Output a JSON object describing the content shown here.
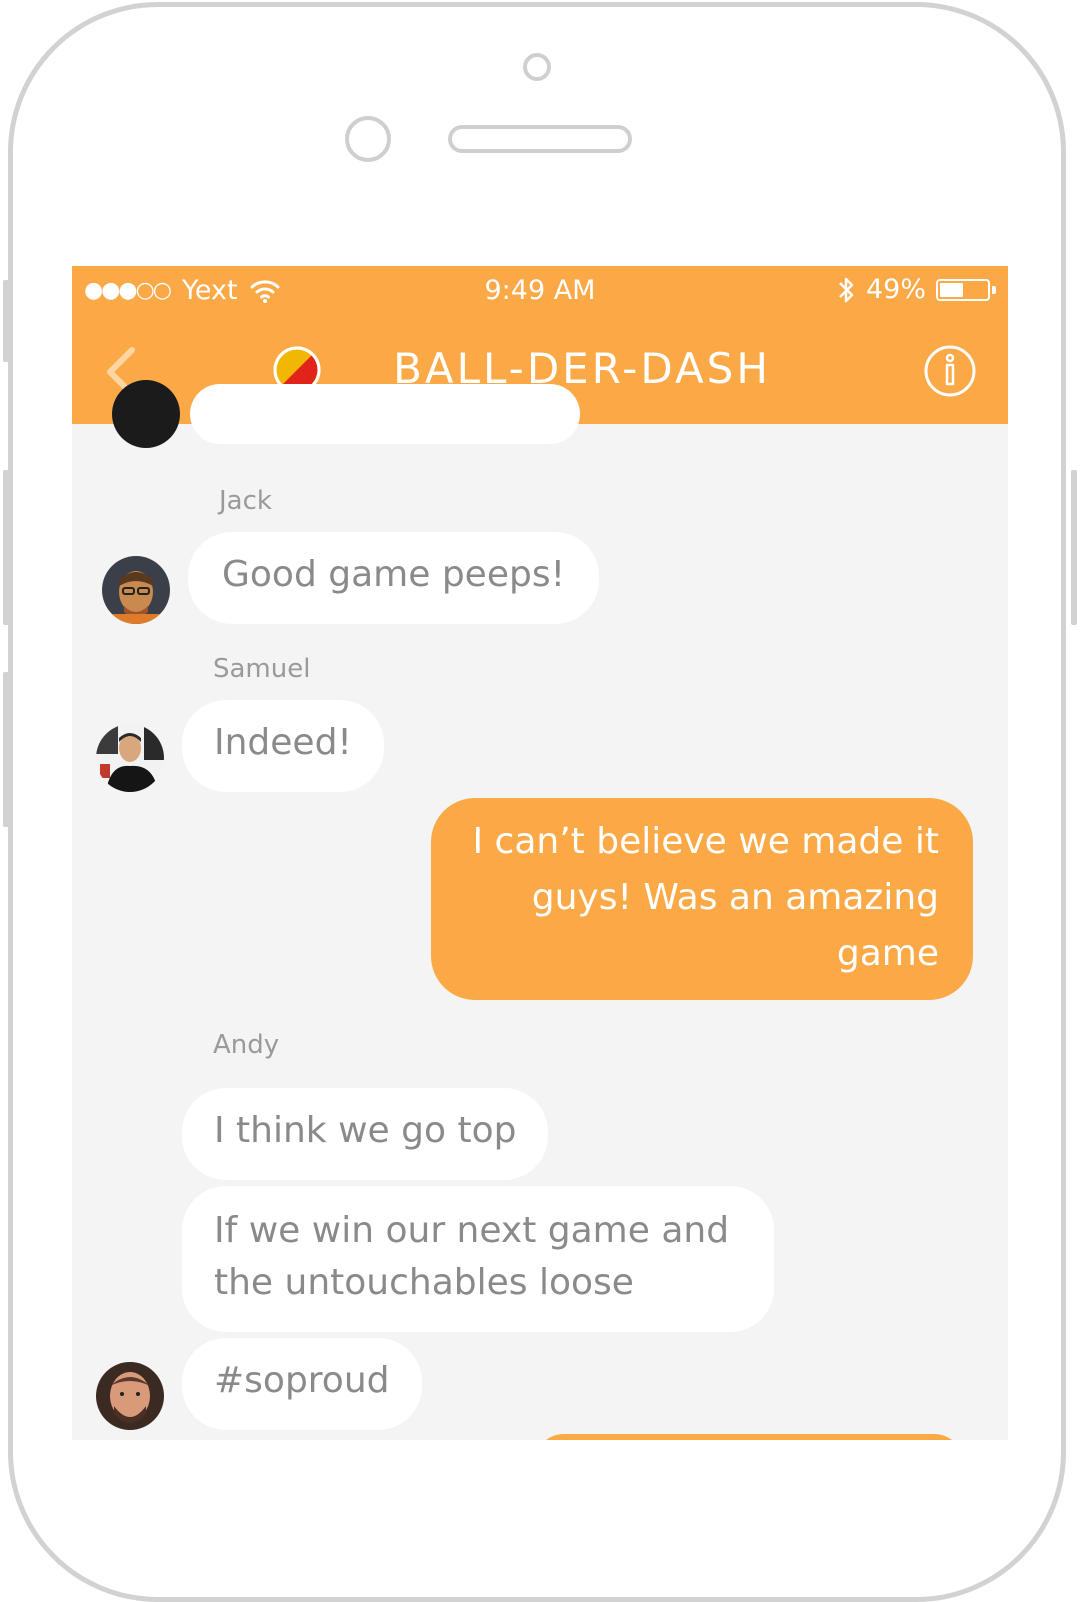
{
  "status_bar": {
    "signal": "●●●○○",
    "carrier": "Yext",
    "time": "9:49 AM",
    "battery_percent": "49%",
    "battery_level": 0.49
  },
  "nav": {
    "title": "BALL-DER-DASH",
    "accent_color": "#fba847"
  },
  "messages": [
    {
      "sender": "Jack",
      "text": "Good game peeps!",
      "direction": "incoming"
    },
    {
      "sender": "Samuel",
      "text": "Indeed!",
      "direction": "incoming"
    },
    {
      "sender": "",
      "text": "I can’t believe we made it\nguys! Was an amazing\ngame",
      "direction": "outgoing"
    },
    {
      "sender": "Andy",
      "text": "I think we go top",
      "direction": "incoming"
    },
    {
      "sender": "",
      "text": "If we win our next game and\nthe untouchables loose",
      "direction": "incoming"
    },
    {
      "sender": "",
      "text": "#soproud",
      "direction": "incoming"
    }
  ],
  "icons": [
    "back-chevron-icon",
    "team-logo-icon",
    "info-icon",
    "wifi-icon",
    "bluetooth-icon",
    "battery-icon"
  ]
}
